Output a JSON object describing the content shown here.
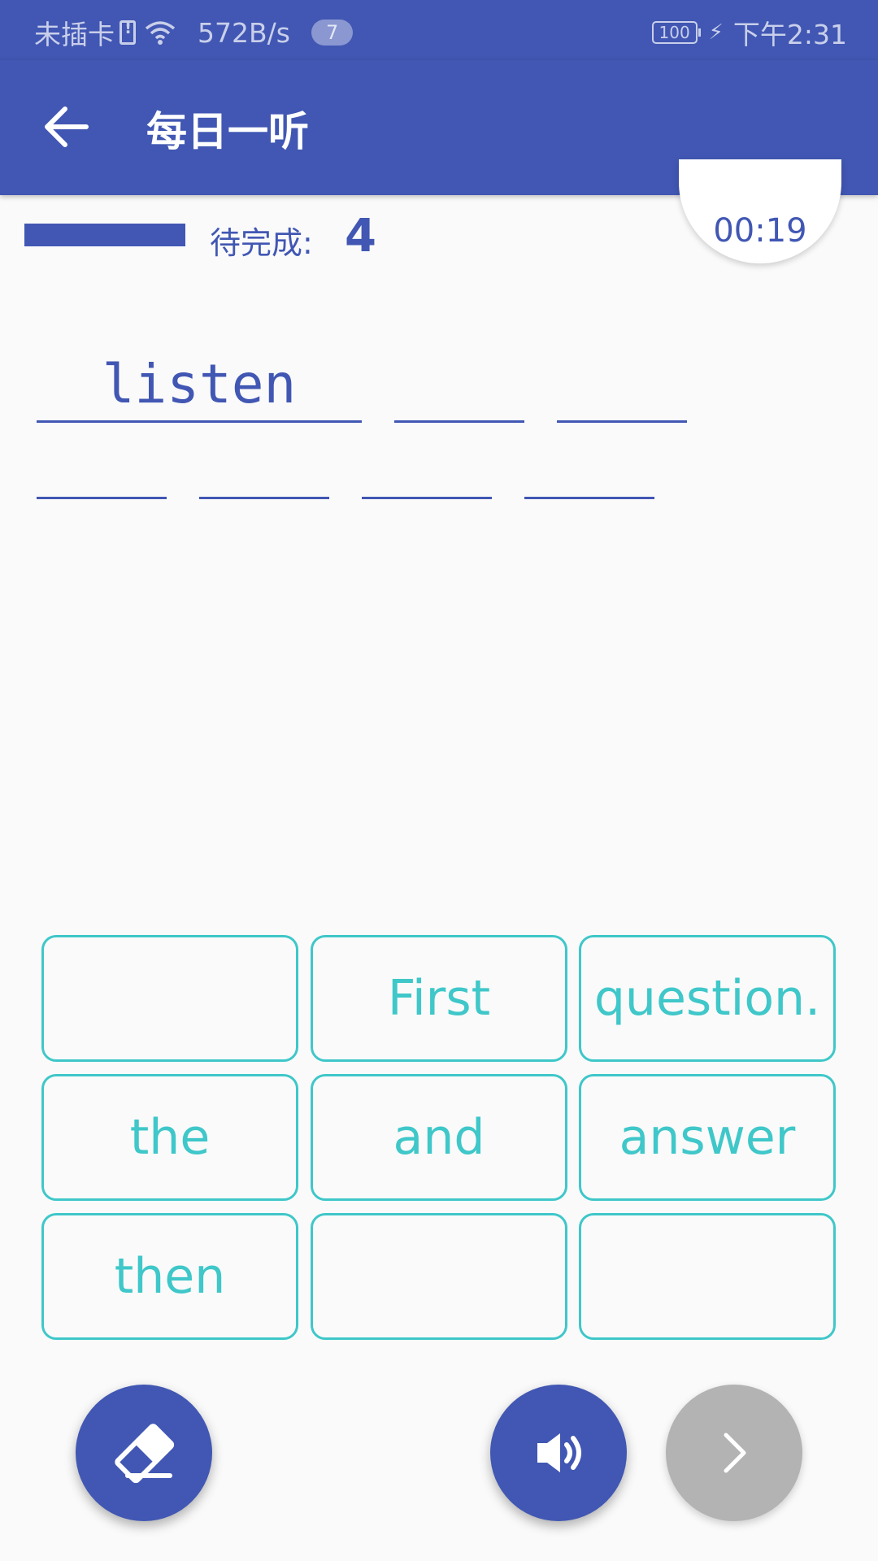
{
  "status_bar": {
    "carrier": "未插卡",
    "net_speed": "572B/s",
    "notifications": "7",
    "battery": "100",
    "time": "下午2:31"
  },
  "header": {
    "title": "每日一听",
    "back_icon": "arrow-left-icon"
  },
  "progress": {
    "fraction": 1.0,
    "remaining_label": "待完成:",
    "remaining_count": "4",
    "timer": "00:19"
  },
  "answer_blanks": [
    "listen",
    "",
    "",
    "",
    "",
    "",
    ""
  ],
  "word_bank": [
    "",
    "First",
    "question.",
    "the",
    "and",
    "answer",
    "then",
    "",
    ""
  ],
  "actions": {
    "erase_icon": "eraser-icon",
    "play_icon": "speaker-icon",
    "next_icon": "chevron-right-icon"
  },
  "colors": {
    "primary": "#4157b3",
    "tile_accent": "#3fc7c9",
    "disabled": "#b3b3b3"
  }
}
